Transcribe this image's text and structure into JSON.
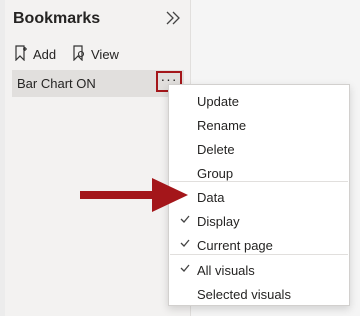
{
  "pane": {
    "title": "Bookmarks",
    "toolbar": {
      "add_label": "Add",
      "view_label": "View"
    },
    "bookmarks": [
      {
        "label": "Bar Chart ON"
      }
    ],
    "more_label": "···"
  },
  "menu": {
    "items": [
      {
        "label": "Update",
        "checked": false
      },
      {
        "label": "Rename",
        "checked": false
      },
      {
        "label": "Delete",
        "checked": false
      },
      {
        "label": "Group",
        "checked": false
      },
      {
        "label": "Data",
        "checked": false
      },
      {
        "label": "Display",
        "checked": true
      },
      {
        "label": "Current page",
        "checked": true
      },
      {
        "label": "All visuals",
        "checked": true
      },
      {
        "label": "Selected visuals",
        "checked": false
      }
    ]
  },
  "colors": {
    "highlight": "#a4161a",
    "pane_bg": "#f3f2f1",
    "selected_item_bg": "#e1dfdd"
  },
  "icons": {
    "collapse": "double-chevron-right-icon",
    "add": "bookmark-add-icon",
    "view": "bookmark-view-icon",
    "more": "more-options-icon",
    "check": "checkmark-icon",
    "annotation": "arrow-right-icon"
  }
}
